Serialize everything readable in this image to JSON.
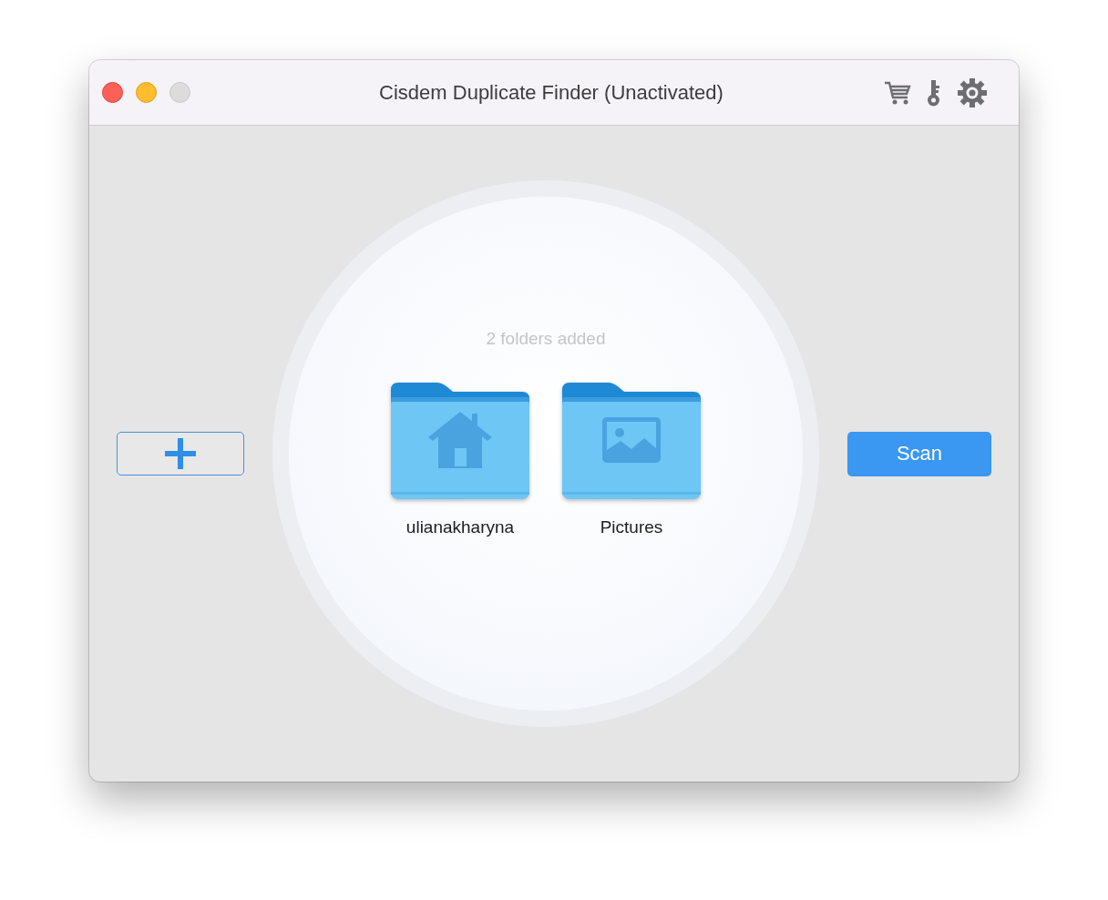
{
  "window": {
    "title": "Cisdem Duplicate Finder (Unactivated)"
  },
  "drop_area": {
    "caption": "2 folders added",
    "folders": [
      {
        "name": "ulianakharyna",
        "kind": "home"
      },
      {
        "name": "Pictures",
        "kind": "pictures"
      }
    ]
  },
  "scan_button": {
    "label": "Scan"
  }
}
